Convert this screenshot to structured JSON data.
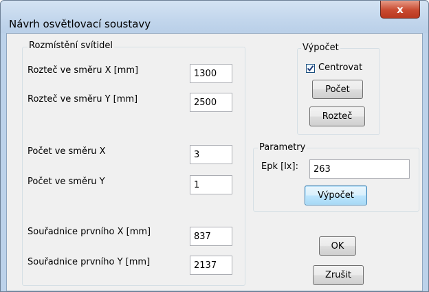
{
  "window": {
    "title": "Návrh osvětlovací soustavy",
    "close_label": "x"
  },
  "placement": {
    "legend": "Rozmístění svítidel",
    "fields": [
      {
        "label": "Rozteč ve směru X [mm]",
        "value": "1300"
      },
      {
        "label": "Rozteč ve směru Y [mm]",
        "value": "2500"
      },
      {
        "label": "Počet ve směru X",
        "value": "3"
      },
      {
        "label": "Počet ve směru Y",
        "value": "1"
      },
      {
        "label": "Souřadnice prvního X [mm]",
        "value": "837"
      },
      {
        "label": "Souřadnice prvního Y [mm]",
        "value": "2137"
      }
    ]
  },
  "calculation": {
    "legend": "Výpočet",
    "center_label": "Centrovat",
    "center_checked": true,
    "count_button": "Počet",
    "spacing_button": "Rozteč"
  },
  "parameters": {
    "legend": "Parametry",
    "epk_label": "Epk [lx]:",
    "epk_value": "263",
    "calculate_button": "Výpočet"
  },
  "dialog": {
    "ok_button": "OK",
    "cancel_button": "Zrušit"
  }
}
